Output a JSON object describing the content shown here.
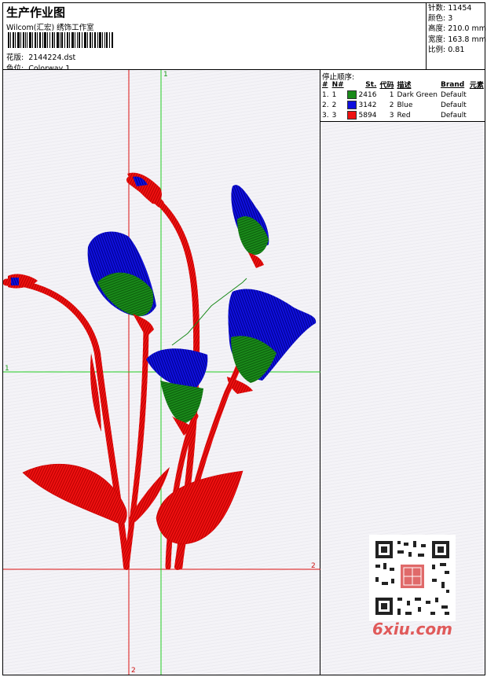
{
  "header": {
    "title": "生产作业图",
    "company": "Wilcom(汇宏) 绣饰工作室",
    "design_label": "花版:",
    "design_value": "2144224.dst",
    "colorway_label": "色位:",
    "colorway_value": "Colorway 1"
  },
  "stats": [
    {
      "label": "针数:",
      "value": "11454"
    },
    {
      "label": "颜色:",
      "value": "3"
    },
    {
      "label": "高度:",
      "value": "210.0 mm"
    },
    {
      "label": "宽度:",
      "value": "163.8 mm"
    },
    {
      "label": "比例:",
      "value": "0.81"
    }
  ],
  "axis_labels": {
    "v_green_top": "1",
    "h_green_left": "1",
    "h_red_right": "2",
    "v_red_bottom": "2"
  },
  "stop_sequence": {
    "title": "停止顺序:",
    "columns": [
      "#",
      "N#",
      "St.",
      "代码",
      "描述",
      "Brand",
      "元素"
    ],
    "rows": [
      {
        "num": "1.",
        "n": "1",
        "color": "#1a8a1a",
        "stitches": "2416",
        "code": "1",
        "desc": "Dark Green",
        "brand": "Default"
      },
      {
        "num": "2.",
        "n": "2",
        "color": "#1010dd",
        "stitches": "3142",
        "code": "2",
        "desc": "Blue",
        "brand": "Default"
      },
      {
        "num": "3.",
        "n": "3",
        "color": "#ee1111",
        "stitches": "5894",
        "code": "3",
        "desc": "Red",
        "brand": "Default"
      }
    ]
  },
  "watermark": {
    "text": "6xiu.com",
    "color": "#e05a5a"
  },
  "colors": {
    "green": "#1a8a1a",
    "blue": "#1010dd",
    "red": "#ee1111",
    "guide_green": "#22cc22",
    "guide_red": "#dd1111"
  }
}
